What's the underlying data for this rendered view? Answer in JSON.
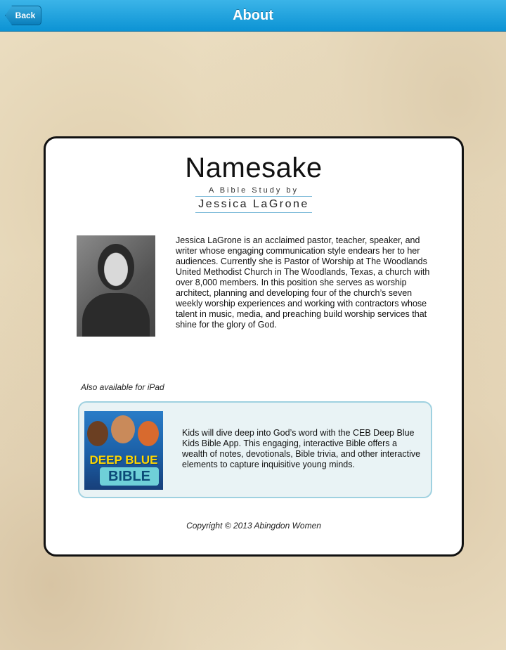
{
  "navbar": {
    "back_label": "Back",
    "title": "About"
  },
  "brand": {
    "title": "Namesake",
    "subtitle": "A Bible Study by",
    "author": "Jessica LaGrone"
  },
  "bio": {
    "text": "Jessica LaGrone is an acclaimed pastor, teacher, speaker, and writer whose engaging communication style endears her to her audiences. Currently she is Pastor of Worship at The Woodlands United Methodist Church in The Woodlands, Texas, a church with over 8,000 members. In this position she serves as worship architect, planning and developing four of the church’s seven weekly worship experiences and working with contractors whose talent in music, media, and preaching build worship services that shine for the glory of God."
  },
  "also_available": "Also available for iPad",
  "promo": {
    "logo_line1": "DEEP BLUE",
    "logo_line2": "BIBLE",
    "text": "Kids will dive deep into God’s word with the CEB Deep Blue Kids Bible App. This engaging, interactive Bible offers a wealth of notes, devotionals, Bible trivia, and other interactive elements to capture inquisitive young minds."
  },
  "copyright": "Copyright © 2013 Abingdon Women",
  "colors": {
    "navbar": "#0c93d4",
    "promo_bg": "#e9f3f5",
    "promo_border": "#9fd1e0"
  }
}
